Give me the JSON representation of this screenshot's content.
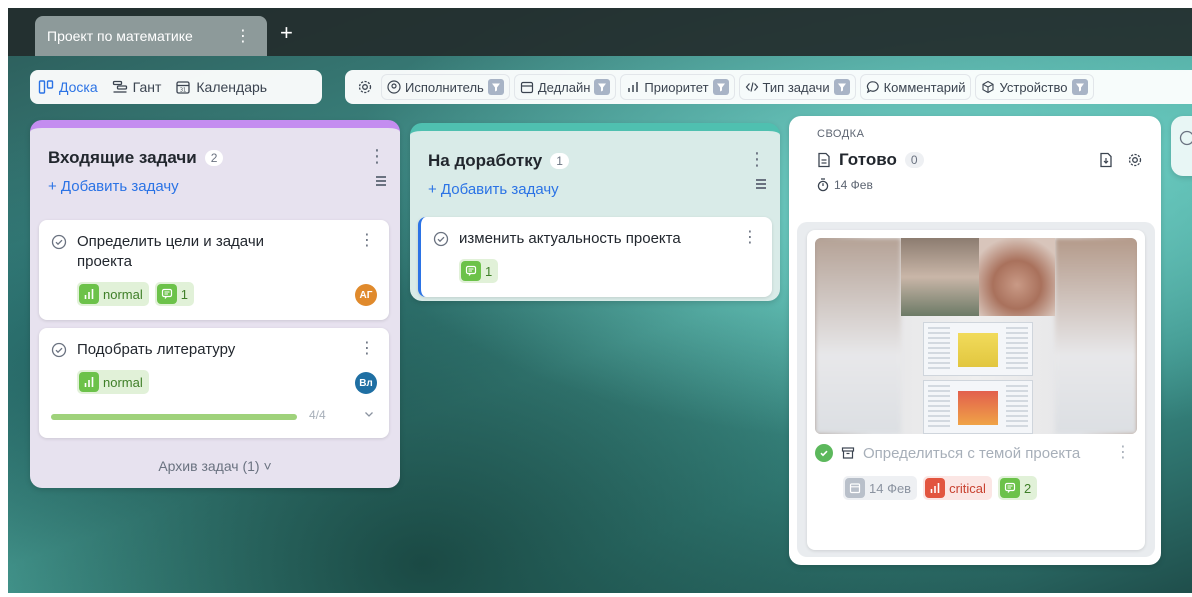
{
  "project_tab": {
    "title": "Проект по математике",
    "kebab": "⋮",
    "add": "+"
  },
  "views": [
    {
      "label": "Доска",
      "icon": "board-icon"
    },
    {
      "label": "Гант",
      "icon": "gantt-icon"
    },
    {
      "label": "Календарь",
      "icon": "calendar-icon"
    }
  ],
  "filters": {
    "settings_icon": "gear-icon",
    "items": [
      {
        "label": "Исполнитель",
        "icon": "user-icon"
      },
      {
        "label": "Дедлайн",
        "icon": "calendar-icon"
      },
      {
        "label": "Приоритет",
        "icon": "priority-icon"
      },
      {
        "label": "Тип задачи",
        "icon": "code-icon"
      },
      {
        "label": "Комментарий",
        "icon": "comment-icon"
      },
      {
        "label": "Устройство",
        "icon": "device-icon"
      }
    ]
  },
  "columns": {
    "incoming": {
      "title": "Входящие задачи",
      "count": "2",
      "add_task": "+ Добавить задачу",
      "archive": "Архив задач (1) ˅",
      "accent": "#c48df0",
      "cards": [
        {
          "title_line1": "Определить цели и задачи",
          "title_line2": "проекта",
          "priority": "normal",
          "comments": "1",
          "avatar": "АГ",
          "avatar_color": "#e08a2c"
        },
        {
          "title": "Подобрать литературу",
          "priority": "normal",
          "avatar": "Вл",
          "avatar_color": "#1f6fa3",
          "progress_label": "4/4",
          "progress_fraction": 1.0
        }
      ]
    },
    "rework": {
      "title": "На доработку",
      "count": "1",
      "add_task": "+ Добавить задачу",
      "accent": "#4fc0b0",
      "cards": [
        {
          "title": "изменить актуальность проекта",
          "comments": "1"
        }
      ]
    },
    "done": {
      "subtitle": "СВОДКА",
      "title": "Готово",
      "count": "0",
      "date": "14 Фев",
      "card": {
        "title": "Определиться с темой проекта",
        "date": "14 Фев",
        "priority": "critical",
        "comments": "2"
      }
    }
  },
  "colors": {
    "accent_blue": "#2b73e5",
    "priority_normal": "#6cc24a",
    "priority_critical": "#e2553f"
  }
}
